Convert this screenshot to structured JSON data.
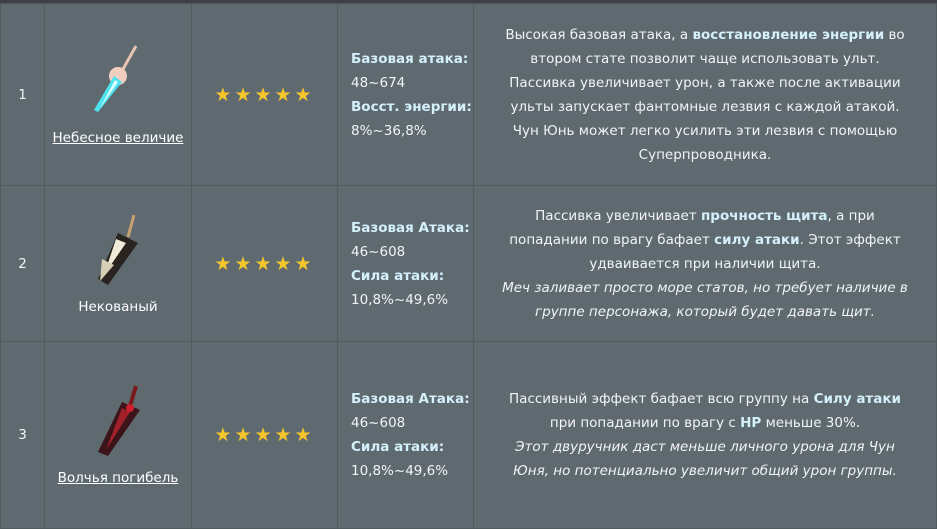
{
  "colors": {
    "background": "#5f6a70",
    "highlight": "#d4f0fb",
    "star": "#f5c62c"
  },
  "rows": [
    {
      "rank": "1",
      "name": "Небесное величие",
      "name_is_link": true,
      "icon": "sword-skyward-blade",
      "stars": 5,
      "stars_text": "★★★★★",
      "stat1_label": "Базовая атака:",
      "stat1_value": "48~674",
      "stat2_label": "Восст. энергии:",
      "stat2_value": "8%~36,8%",
      "desc_pre": "Высокая базовая атака, а ",
      "desc_bold1": "восстановление энергии",
      "desc_mid": " во втором стате позволит чаще использовать ульт. Пассивка увеличивает урон, а также после активации ульты запускает фантомные лезвия с каждой атакой. Чун Юнь может легко усилить эти лезвия с помощью Суперпроводника.",
      "desc_bold2": "",
      "desc_post": "",
      "desc_italic": ""
    },
    {
      "rank": "2",
      "name": "Некованый",
      "name_is_link": false,
      "icon": "claymore-unforged",
      "stars": 5,
      "stars_text": "★★★★★",
      "stat1_label": "Базовая Атака:",
      "stat1_value": "46~608",
      "stat2_label": "Сила атаки:",
      "stat2_value": "10,8%~49,6%",
      "desc_pre": "Пассивка увеличивает ",
      "desc_bold1": "прочность щита",
      "desc_mid": ", а при попадании по врагу бафает ",
      "desc_bold2": "силу атаки",
      "desc_post": ". Этот эффект удваивается при наличии щита.",
      "desc_italic": "Меч заливает просто море статов, но требует наличие в группе персонажа, который будет давать щит."
    },
    {
      "rank": "3",
      "name": "Волчья погибель",
      "name_is_link": true,
      "icon": "claymore-wolfs-gravestone",
      "stars": 5,
      "stars_text": "★★★★★",
      "stat1_label": "Базовая Атака:",
      "stat1_value": "46~608",
      "stat2_label": "Сила атаки:",
      "stat2_value": "10,8%~49,6%",
      "desc_pre": "Пассивный эффект бафает всю группу на ",
      "desc_bold1": "Силу атаки",
      "desc_mid": " при попадании по врагу с ",
      "desc_bold2": "HP",
      "desc_post": " меньше 30%.",
      "desc_italic": "Этот двуручник даст меньше личного урона для Чун Юня, но потенциально увеличит общий урон группы."
    }
  ]
}
